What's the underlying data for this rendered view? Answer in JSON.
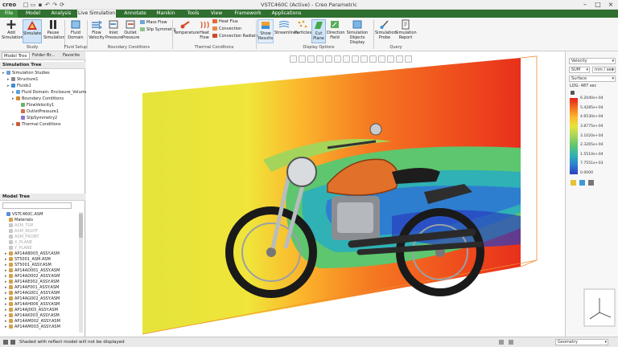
{
  "app": {
    "logo": "creo",
    "title": "VSTC460C (Active) - Creo Parametric"
  },
  "tabs": [
    "File",
    "Model",
    "Analysis",
    "Live Simulation",
    "Annotate",
    "Manikin",
    "Tools",
    "View",
    "Framework",
    "Applications"
  ],
  "active_tab": "Live Simulation",
  "ribbon": {
    "buttons": [
      {
        "name": "add-simulation",
        "label": "Add Simulation",
        "icon": "plus-icon"
      },
      {
        "name": "simulate",
        "label": "Simulate",
        "icon": "simulate-icon"
      },
      {
        "name": "pause-simulation",
        "label": "Pause Simulation",
        "icon": "pause-icon"
      },
      {
        "name": "fluid-domain",
        "label": "Fluid Domain",
        "icon": "fluid-domain-icon"
      },
      {
        "name": "flow-velocity",
        "label": "Flow Velocity",
        "icon": "flow-velocity-icon"
      },
      {
        "name": "inlet-pressure",
        "label": "Inlet Pressure",
        "icon": "inlet-pressure-icon"
      },
      {
        "name": "outlet-pressure",
        "label": "Outlet Pressure",
        "icon": "outlet-pressure-icon"
      },
      {
        "name": "temperature",
        "label": "Temperature",
        "icon": "temperature-icon"
      },
      {
        "name": "heat-flow",
        "label": "Heat Flow",
        "icon": "heat-flow-icon"
      },
      {
        "name": "show-results",
        "label": "Show Results",
        "icon": "show-results-icon"
      },
      {
        "name": "streamlines",
        "label": "Streamlines",
        "icon": "streamlines-icon"
      },
      {
        "name": "particles",
        "label": "Particles",
        "icon": "particles-icon"
      },
      {
        "name": "cut-plane",
        "label": "Cut Plane",
        "icon": "cut-plane-icon"
      },
      {
        "name": "direction-field",
        "label": "Direction Field",
        "icon": "direction-field-icon"
      },
      {
        "name": "simulation-objects-display",
        "label": "Simulation Objects Display",
        "icon": "objects-display-icon"
      },
      {
        "name": "simulation-probe",
        "label": "Simulation Probe",
        "icon": "probe-icon"
      },
      {
        "name": "simulation-report",
        "label": "Simulation Report",
        "icon": "report-icon"
      }
    ],
    "small_items": {
      "mass_flow": "Mass Flow",
      "slip_symmetry": "Slip Symmetry",
      "heat_flux": "Heat Flux",
      "convection": "Convection",
      "convection_radiation": "Convection Radiation"
    },
    "groups": [
      "Study",
      "Fluid Setup",
      "Boundary Conditions",
      "Thermal Conditions",
      "Display Options",
      "Query"
    ]
  },
  "left_panel": {
    "tabs": [
      "Model Tree",
      "Folder Br...",
      "Favorite"
    ],
    "simulation_tree": {
      "header": "Simulation Tree",
      "nodes": [
        {
          "label": "Simulation Studies",
          "level": 0
        },
        {
          "label": "Structure1",
          "level": 1
        },
        {
          "label": "Fluids1",
          "level": 1
        },
        {
          "label": "Fluid Domain: Enclosure_Volume_1",
          "level": 2
        },
        {
          "label": "Boundary Conditions",
          "level": 2
        },
        {
          "label": "FlowVelocity1",
          "level": 3
        },
        {
          "label": "OutletPressure1",
          "level": 3
        },
        {
          "label": "SlipSymmetry2",
          "level": 3
        },
        {
          "label": "Thermal Conditions",
          "level": 2
        }
      ]
    },
    "model_tree": {
      "header": "Model Tree",
      "nodes": [
        {
          "label": "VSTC460C.ASM",
          "dim": false
        },
        {
          "label": "Materials",
          "dim": false
        },
        {
          "label": "ASM_TOP",
          "dim": true
        },
        {
          "label": "ASM_RIGHT",
          "dim": true
        },
        {
          "label": "ASM_FRONT",
          "dim": true
        },
        {
          "label": "X_PLANE",
          "dim": true
        },
        {
          "label": "Y_PLANE",
          "dim": true
        },
        {
          "label": "AP14AB003_ASSY.ASM",
          "dim": false
        },
        {
          "label": "ST5001_ASM.ASM",
          "dim": false
        },
        {
          "label": "ST5001_ASSY.ASM",
          "dim": false
        },
        {
          "label": "AP14AD001_ASSY.ASM",
          "dim": false
        },
        {
          "label": "AP14AD002_ASSY.ASM",
          "dim": false
        },
        {
          "label": "AP14AE002_ASSY.ASM",
          "dim": false
        },
        {
          "label": "AP14AF001_ASSY.ASM",
          "dim": false
        },
        {
          "label": "AP14AG001_ASSY.ASM",
          "dim": false
        },
        {
          "label": "AP14AG002_ASSY.ASM",
          "dim": false
        },
        {
          "label": "AP14AH006_ASSY.ASM",
          "dim": false
        },
        {
          "label": "AP14AJ003_ASSY.ASM",
          "dim": false
        },
        {
          "label": "AP14AK003_ASSY.ASM",
          "dim": false
        },
        {
          "label": "AP14AM002_ASSY.ASM",
          "dim": false
        },
        {
          "label": "AP14AM003_ASSY.ASM",
          "dim": false
        }
      ]
    }
  },
  "right_panel": {
    "quantity": "Velocity",
    "component": "SUM",
    "unit": "mm / sec",
    "display": "Surface",
    "time": "LOG: 487 sec",
    "legend_values": [
      "6.2040e+04",
      "5.4285e+04",
      "4.6530e+04",
      "3.8775e+04",
      "3.1020e+04",
      "2.3265e+04",
      "1.5510e+04",
      "7.7551e+03",
      "0.0000"
    ],
    "legend_colors": [
      "#e8201c",
      "#f46d1f",
      "#fdb92c",
      "#e6e43b",
      "#a5d45a",
      "#5ec66e",
      "#2fb1b5",
      "#2e7ed0",
      "#2a3fbf"
    ]
  },
  "status": {
    "message": "Shaded with reflect model will not be displayed",
    "filter": "Geometry"
  }
}
